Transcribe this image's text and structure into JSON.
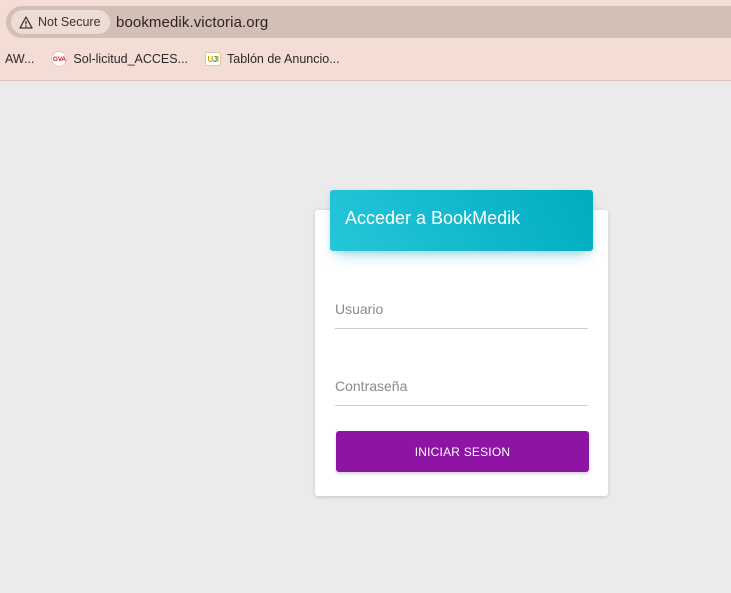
{
  "browser": {
    "security_label": "Not Secure",
    "url": "bookmedik.victoria.org",
    "bookmarks": [
      {
        "label": "AW...",
        "icon": "none"
      },
      {
        "label": "Sol-licitud_ACCES...",
        "icon": "gva-logo-icon",
        "icon_text": "GVA"
      },
      {
        "label": "Tablón de Anuncio...",
        "icon": "uji-logo-icon",
        "icon_text": "UJI"
      }
    ]
  },
  "login": {
    "title": "Acceder a BookMedik",
    "username_placeholder": "Usuario",
    "password_placeholder": "Contraseña",
    "submit_label": "INICIAR SESION"
  },
  "colors": {
    "header_gradient": [
      "#26c6da",
      "#00acc1"
    ],
    "submit_button": "#8e14a6",
    "page_background": "#ebebeb",
    "chrome_background": "#f3ddd5"
  }
}
